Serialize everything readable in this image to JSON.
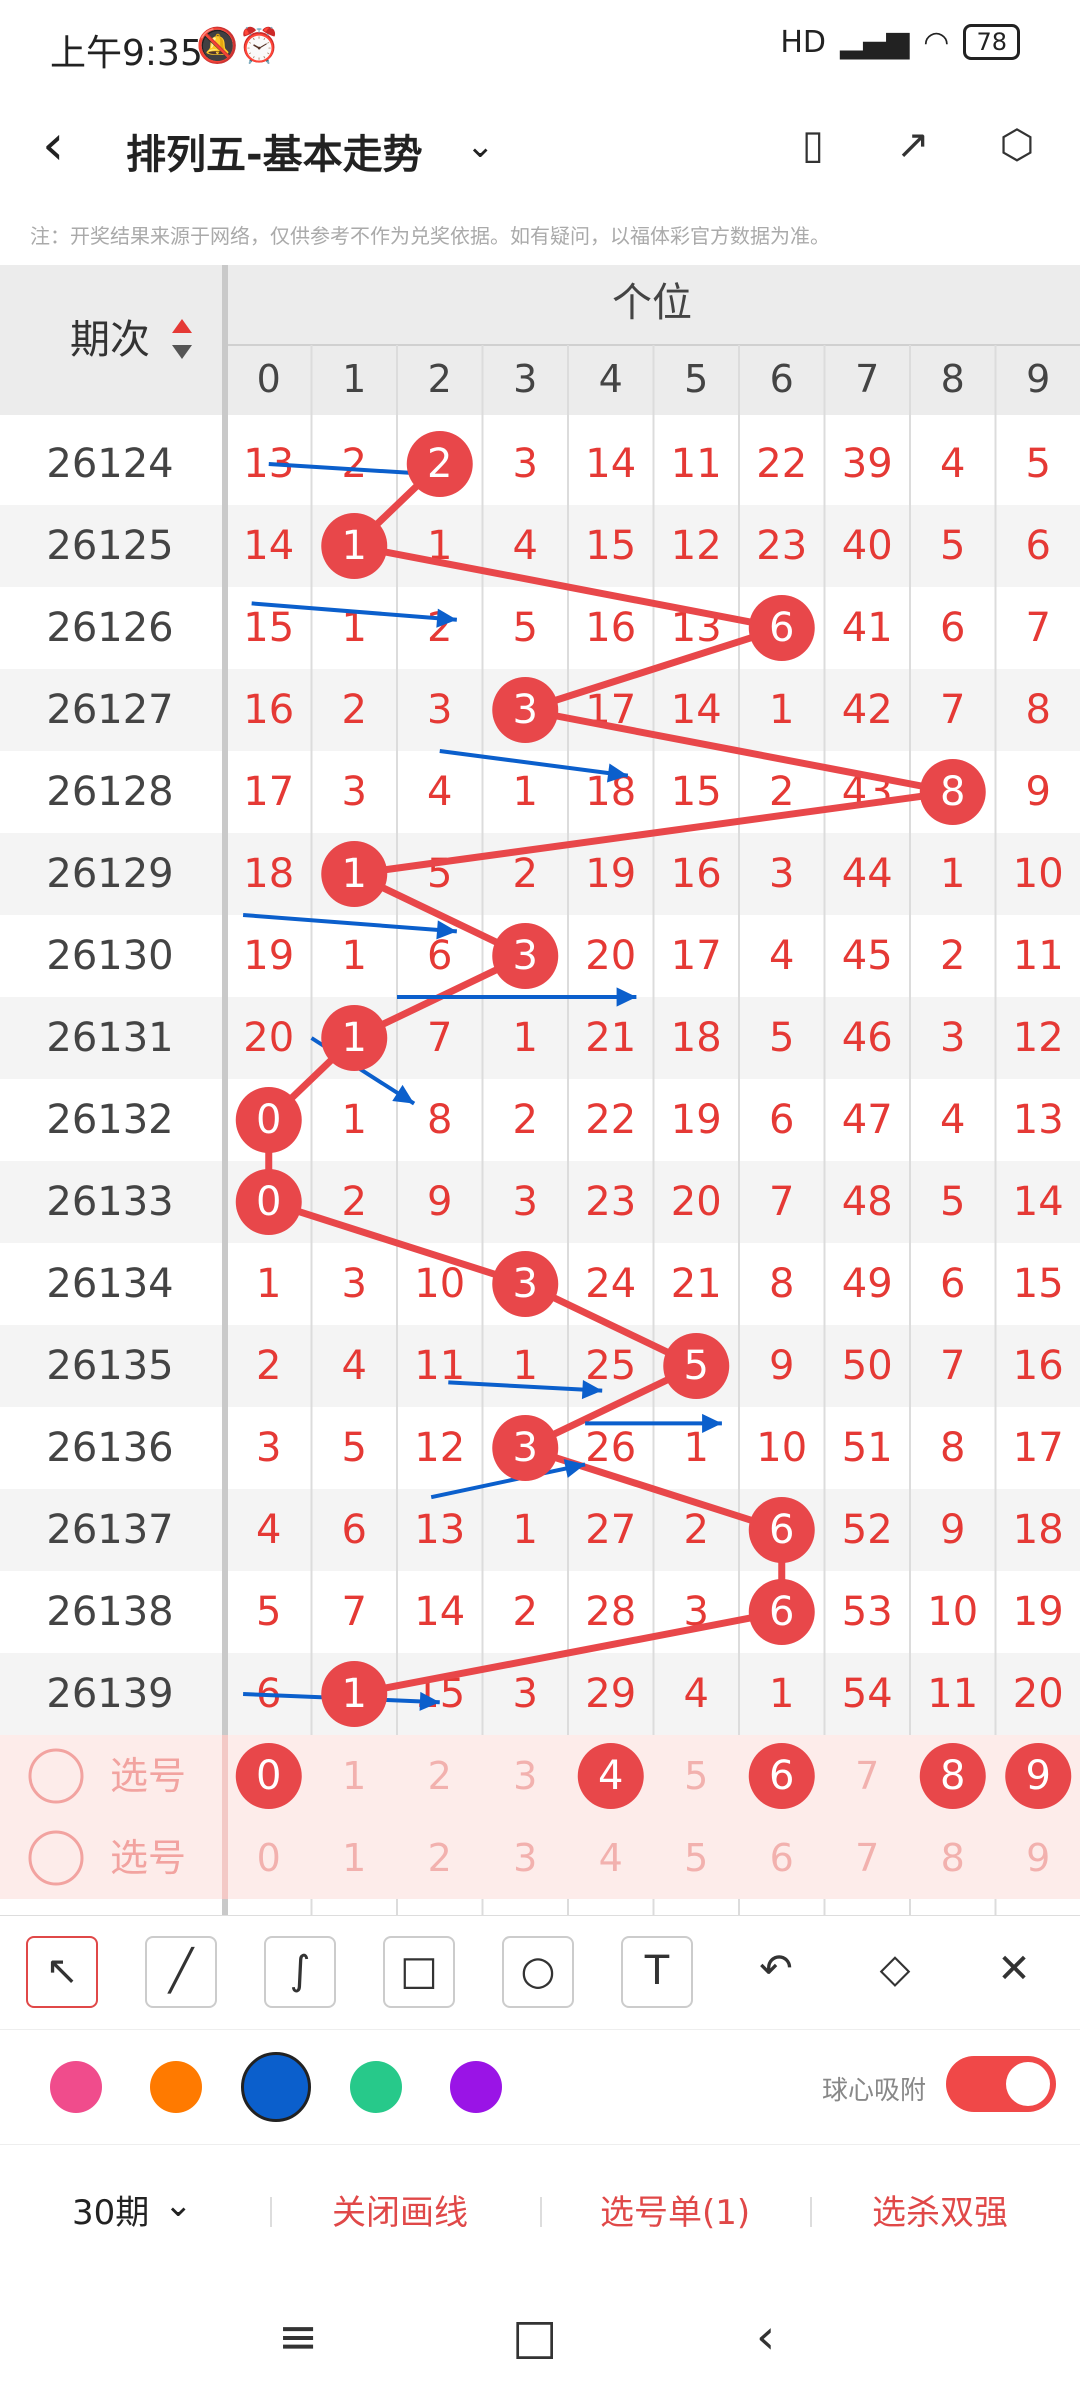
{
  "status_bar": {
    "time": "上午9:35",
    "network": "HD",
    "battery": "78"
  },
  "header": {
    "title": "排列五-基本走势",
    "back_icon": "chevron-left-icon",
    "dropdown_icon": "chevron-down-icon",
    "actions": [
      "layout-icon",
      "share-icon",
      "settings-icon"
    ]
  },
  "notice": "注：开奖结果来源于网络，仅供参考不作为兑奖依据。如有疑问，以福体彩官方数据为准。",
  "table": {
    "period_header": "期次",
    "group_header": "个位",
    "digits": [
      "0",
      "1",
      "2",
      "3",
      "4",
      "5",
      "6",
      "7",
      "8",
      "9"
    ],
    "rows": [
      {
        "period": "26124",
        "cells": [
          13,
          2,
          2,
          3,
          14,
          11,
          22,
          39,
          4,
          5
        ],
        "win": 2
      },
      {
        "period": "26125",
        "cells": [
          14,
          1,
          1,
          4,
          15,
          12,
          23,
          40,
          5,
          6
        ],
        "win": 1
      },
      {
        "period": "26126",
        "cells": [
          15,
          1,
          2,
          5,
          16,
          13,
          6,
          41,
          6,
          7
        ],
        "win": 6
      },
      {
        "period": "26127",
        "cells": [
          16,
          2,
          3,
          3,
          17,
          14,
          1,
          42,
          7,
          8
        ],
        "win": 3
      },
      {
        "period": "26128",
        "cells": [
          17,
          3,
          4,
          1,
          18,
          15,
          2,
          43,
          8,
          9
        ],
        "win": 8
      },
      {
        "period": "26129",
        "cells": [
          18,
          1,
          5,
          2,
          19,
          16,
          3,
          44,
          1,
          10
        ],
        "win": 1
      },
      {
        "period": "26130",
        "cells": [
          19,
          1,
          6,
          3,
          20,
          17,
          4,
          45,
          2,
          11
        ],
        "win": 3
      },
      {
        "period": "26131",
        "cells": [
          20,
          1,
          7,
          1,
          21,
          18,
          5,
          46,
          3,
          12
        ],
        "win": 1
      },
      {
        "period": "26132",
        "cells": [
          0,
          1,
          8,
          2,
          22,
          19,
          6,
          47,
          4,
          13
        ],
        "win": 0
      },
      {
        "period": "26133",
        "cells": [
          0,
          2,
          9,
          3,
          23,
          20,
          7,
          48,
          5,
          14
        ],
        "win": 0
      },
      {
        "period": "26134",
        "cells": [
          1,
          3,
          10,
          3,
          24,
          21,
          8,
          49,
          6,
          15
        ],
        "win": 3
      },
      {
        "period": "26135",
        "cells": [
          2,
          4,
          11,
          1,
          25,
          5,
          9,
          50,
          7,
          16
        ],
        "win": 5
      },
      {
        "period": "26136",
        "cells": [
          3,
          5,
          12,
          3,
          26,
          1,
          10,
          51,
          8,
          17
        ],
        "win": 3
      },
      {
        "period": "26137",
        "cells": [
          4,
          6,
          13,
          1,
          27,
          2,
          6,
          52,
          9,
          18
        ],
        "win": 6
      },
      {
        "period": "26138",
        "cells": [
          5,
          7,
          14,
          2,
          28,
          3,
          6,
          53,
          10,
          19
        ],
        "win": 6
      },
      {
        "period": "26139",
        "cells": [
          6,
          1,
          15,
          3,
          29,
          4,
          1,
          54,
          11,
          20
        ],
        "win": 1
      }
    ],
    "select_rows": [
      {
        "label": "选号",
        "selected": [
          0,
          4,
          6,
          8,
          9
        ]
      },
      {
        "label": "选号",
        "selected": []
      }
    ]
  },
  "toolbar": {
    "tools": [
      "arrow-tool-icon",
      "line-tool-icon",
      "curve-tool-icon",
      "rectangle-tool-icon",
      "circle-tool-icon",
      "text-tool-icon",
      "undo-icon",
      "eraser-icon",
      "clear-icon"
    ],
    "selected": "arrow-tool-icon"
  },
  "palette": {
    "colors": [
      "#f04c8c",
      "#ff7a00",
      "#0b5fcc",
      "#27c98a",
      "#9a14e6"
    ],
    "selected": "#0b5fcc",
    "snap_label": "球心吸附",
    "snap_on": true
  },
  "bottom_bar": {
    "period_select": "30期",
    "close_lines": "关闭画线",
    "pick_list": "选号单(1)",
    "kill_double": "选杀双强"
  },
  "system_nav": [
    "menu-icon",
    "home-icon",
    "back-icon"
  ]
}
